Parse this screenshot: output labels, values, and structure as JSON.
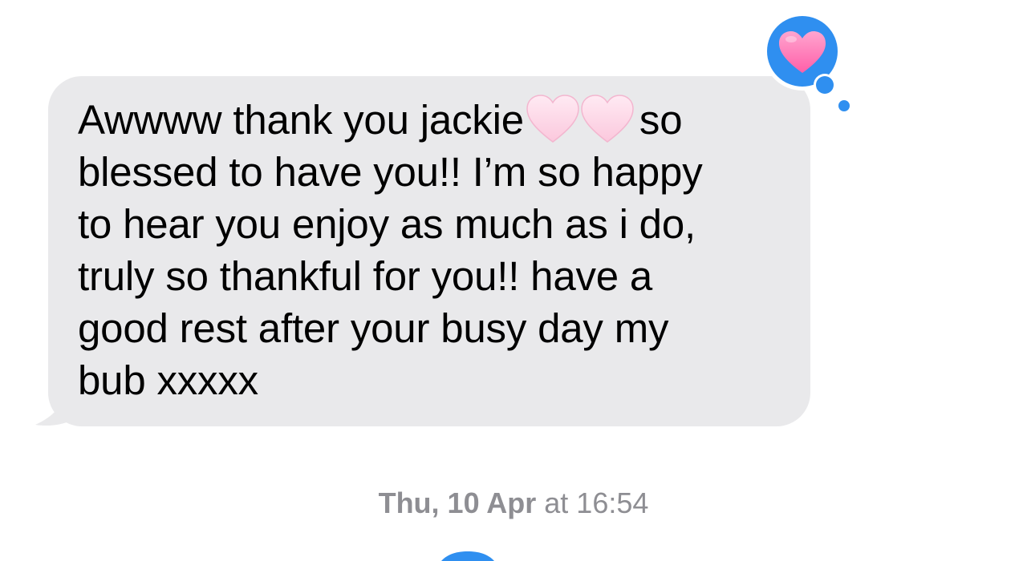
{
  "conversation": {
    "message": {
      "lines": [
        {
          "before": "Awwww thank you jackie",
          "emoji": "two-pink-hearts",
          "after": "so"
        },
        {
          "text": "blessed to have you!! I’m so happy"
        },
        {
          "text": "to hear you enjoy as much as i do,"
        },
        {
          "text": "truly so thankful for you!! have a"
        },
        {
          "text": "good rest after your busy day my"
        },
        {
          "text": "bub xxxxx"
        }
      ],
      "bubble_color": "#e9e9eb",
      "reaction": {
        "icon": "pink-heart-icon",
        "bubble_color": "#2f8ff0",
        "heart_color": "#ff7ab8"
      }
    },
    "timestamp": {
      "date": "Thu, 10 Apr",
      "time": "at 16:54"
    },
    "colors": {
      "accent": "#2f8ff0",
      "timestamp": "#8e8e93"
    }
  }
}
